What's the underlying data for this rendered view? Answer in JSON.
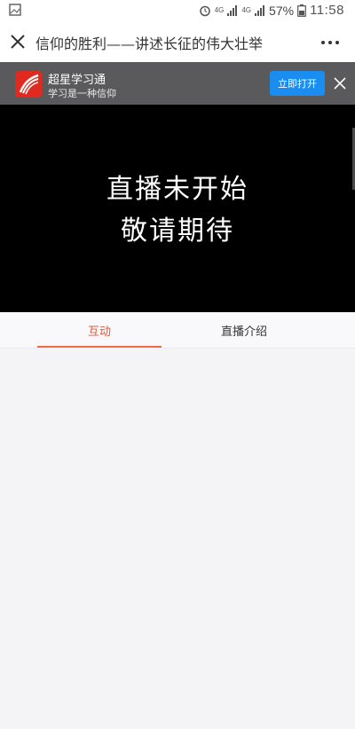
{
  "status_bar": {
    "network1": "4G",
    "network2": "4G",
    "battery_percent": "57%",
    "time": "11:58"
  },
  "title_bar": {
    "title": "信仰的胜利——讲述长征的伟大壮举"
  },
  "banner": {
    "app_name": "超星学习通",
    "slogan": "学习是一种信仰",
    "open_button": "立即打开"
  },
  "player": {
    "message_line1": "直播未开始",
    "message_line2": "敬请期待"
  },
  "tabs": [
    {
      "label": "互动",
      "active": true
    },
    {
      "label": "直播介绍",
      "active": false
    }
  ],
  "colors": {
    "accent": "#f06a48",
    "open_button": "#1a8df0",
    "logo_red": "#e02a20",
    "banner_bg": "#5a5a5c"
  }
}
